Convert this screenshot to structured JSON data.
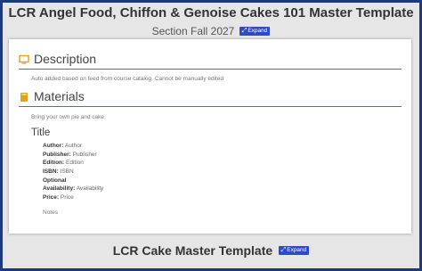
{
  "course": {
    "title": "LCR Angel Food, Chiffon & Genoise Cakes 101 Master Template",
    "section": "Section Fall 2027",
    "expand_label": "Expand"
  },
  "description": {
    "heading": "Description",
    "text": "Auto added based on feed from course catalog. Cannot be manually edited",
    "icon": "monitor-icon"
  },
  "materials": {
    "heading": "Materials",
    "intro": "Bring your own pie and cake",
    "icon": "book-icon",
    "item": {
      "title": "Title",
      "rows": [
        {
          "label": "Author:",
          "value": "Author"
        },
        {
          "label": "Publisher:",
          "value": "Publisher"
        },
        {
          "label": "Edition:",
          "value": "Edition"
        },
        {
          "label": "ISBN:",
          "value": "ISBN"
        },
        {
          "label": "Optional",
          "value": ""
        },
        {
          "label": "Availability:",
          "value": "Availability"
        },
        {
          "label": "Price:",
          "value": "Price"
        }
      ],
      "notes": "Notes"
    }
  },
  "next_course": {
    "title": "LCR Cake Master Template",
    "expand_label": "Expand"
  },
  "colors": {
    "frame_border": "#1f3a7a",
    "expand_button": "#2e4bbf",
    "section_rule": "#4a6fc1",
    "icon_gold": "#e0a516"
  }
}
